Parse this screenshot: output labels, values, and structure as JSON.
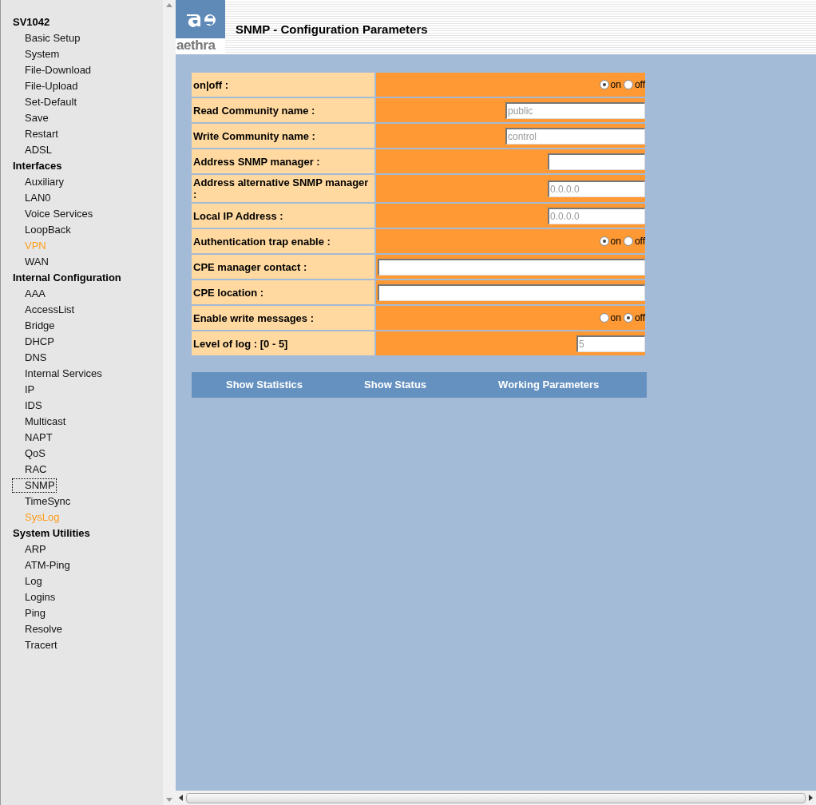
{
  "sidebar": {
    "groups": [
      {
        "title": "SV1042",
        "items": [
          {
            "label": "Basic Setup",
            "visited": false,
            "focused": false
          },
          {
            "label": "System",
            "visited": false,
            "focused": false
          },
          {
            "label": "File-Download",
            "visited": false,
            "focused": false
          },
          {
            "label": "File-Upload",
            "visited": false,
            "focused": false
          },
          {
            "label": "Set-Default",
            "visited": false,
            "focused": false
          },
          {
            "label": "Save",
            "visited": false,
            "focused": false
          },
          {
            "label": "Restart",
            "visited": false,
            "focused": false
          },
          {
            "label": "ADSL",
            "visited": false,
            "focused": false
          }
        ]
      },
      {
        "title": "Interfaces",
        "items": [
          {
            "label": "Auxiliary",
            "visited": false,
            "focused": false
          },
          {
            "label": "LAN0",
            "visited": false,
            "focused": false
          },
          {
            "label": "Voice Services",
            "visited": false,
            "focused": false
          },
          {
            "label": "LoopBack",
            "visited": false,
            "focused": false
          },
          {
            "label": "VPN",
            "visited": true,
            "focused": false
          },
          {
            "label": "WAN",
            "visited": false,
            "focused": false
          }
        ]
      },
      {
        "title": "Internal Configuration",
        "items": [
          {
            "label": "AAA",
            "visited": false,
            "focused": false
          },
          {
            "label": "AccessList",
            "visited": false,
            "focused": false
          },
          {
            "label": "Bridge",
            "visited": false,
            "focused": false
          },
          {
            "label": "DHCP",
            "visited": false,
            "focused": false
          },
          {
            "label": "DNS",
            "visited": false,
            "focused": false
          },
          {
            "label": "Internal Services",
            "visited": false,
            "focused": false
          },
          {
            "label": "IP",
            "visited": false,
            "focused": false
          },
          {
            "label": "IDS",
            "visited": false,
            "focused": false
          },
          {
            "label": "Multicast",
            "visited": false,
            "focused": false
          },
          {
            "label": "NAPT",
            "visited": false,
            "focused": false
          },
          {
            "label": "QoS",
            "visited": false,
            "focused": false
          },
          {
            "label": "RAC",
            "visited": false,
            "focused": false
          },
          {
            "label": "SNMP",
            "visited": false,
            "focused": true
          },
          {
            "label": "TimeSync",
            "visited": false,
            "focused": false
          },
          {
            "label": "SysLog",
            "visited": true,
            "focused": false
          }
        ]
      },
      {
        "title": "System Utilities",
        "items": [
          {
            "label": "ARP",
            "visited": false,
            "focused": false
          },
          {
            "label": "ATM-Ping",
            "visited": false,
            "focused": false
          },
          {
            "label": "Log",
            "visited": false,
            "focused": false
          },
          {
            "label": "Logins",
            "visited": false,
            "focused": false
          },
          {
            "label": "Ping",
            "visited": false,
            "focused": false
          },
          {
            "label": "Resolve",
            "visited": false,
            "focused": false
          },
          {
            "label": "Tracert",
            "visited": false,
            "focused": false
          }
        ]
      }
    ]
  },
  "header": {
    "logo": "aethra",
    "title": "SNMP - Configuration Parameters"
  },
  "form": [
    {
      "kind": "radio",
      "label": "on|off :",
      "options": [
        {
          "label": "on",
          "selected": true
        },
        {
          "label": "off",
          "selected": false
        }
      ]
    },
    {
      "kind": "field",
      "label": "Read Community name :",
      "value": "public"
    },
    {
      "kind": "field",
      "label": "Write Community name :",
      "value": "control"
    },
    {
      "kind": "short",
      "label": "Address SNMP manager :"
    },
    {
      "kind": "short",
      "label": "Address alternative SNMP manager :",
      "value": "0.0.0.0"
    },
    {
      "kind": "short",
      "label": "Local IP Address :",
      "value": "0.0.0.0"
    },
    {
      "kind": "radio",
      "label": "Authentication trap enable :",
      "options": [
        {
          "label": "on",
          "selected": true
        },
        {
          "label": "off",
          "selected": false
        }
      ]
    },
    {
      "kind": "wide",
      "label": "CPE manager contact :"
    },
    {
      "kind": "wide",
      "label": "CPE location :"
    },
    {
      "kind": "radio",
      "label": "Enable write messages :",
      "options": [
        {
          "label": "on",
          "selected": false
        },
        {
          "label": "off",
          "selected": true
        }
      ]
    },
    {
      "kind": "tiny",
      "label": "Level of log : [0 - 5]",
      "value": "5"
    }
  ],
  "links": [
    "Show Statistics",
    "Show Status",
    "Working Parameters"
  ]
}
